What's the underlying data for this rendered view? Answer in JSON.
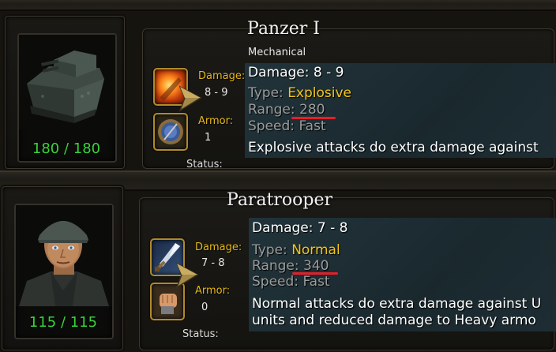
{
  "units": [
    {
      "name": "Panzer I",
      "class": "Mechanical",
      "hp": "180 / 180",
      "damage_label": "Damage:",
      "damage_value": "8 - 9",
      "armor_label": "Armor:",
      "armor_value": "1",
      "status_label": "Status:",
      "portrait_icon": "tank-portrait",
      "attack_icon": "explosive-attack-icon",
      "armor_icon": "shield-armor-icon",
      "tooltip": {
        "damage": "Damage: 8 - 9",
        "type_prefix": "Type: ",
        "type_value": "Explosive",
        "range_prefix": "Range: ",
        "range_value": "280",
        "speed_prefix": "Speed: ",
        "speed_value": "Fast",
        "description": "Explosive attacks do extra damage against"
      }
    },
    {
      "name": "Paratrooper",
      "class": "",
      "hp": "115 / 115",
      "damage_label": "Damage:",
      "damage_value": "7 - 8",
      "armor_label": "Armor:",
      "armor_value": "0",
      "status_label": "Status:",
      "portrait_icon": "soldier-portrait",
      "attack_icon": "sword-attack-icon",
      "armor_icon": "fist-armor-icon",
      "tooltip": {
        "damage": "Damage: 7 - 8",
        "type_prefix": "Type: ",
        "type_value": "Normal",
        "range_prefix": "Range: ",
        "range_value": "340",
        "speed_prefix": "Speed: ",
        "speed_value": "Fast",
        "description_1": "Normal attacks do extra damage against U",
        "description_2": "units and reduced damage to Heavy armo"
      }
    }
  ],
  "colors": {
    "hp": "#39d539",
    "label_gold": "#e6b818",
    "type_value": "#f5c518",
    "underline": "#e3202a"
  }
}
